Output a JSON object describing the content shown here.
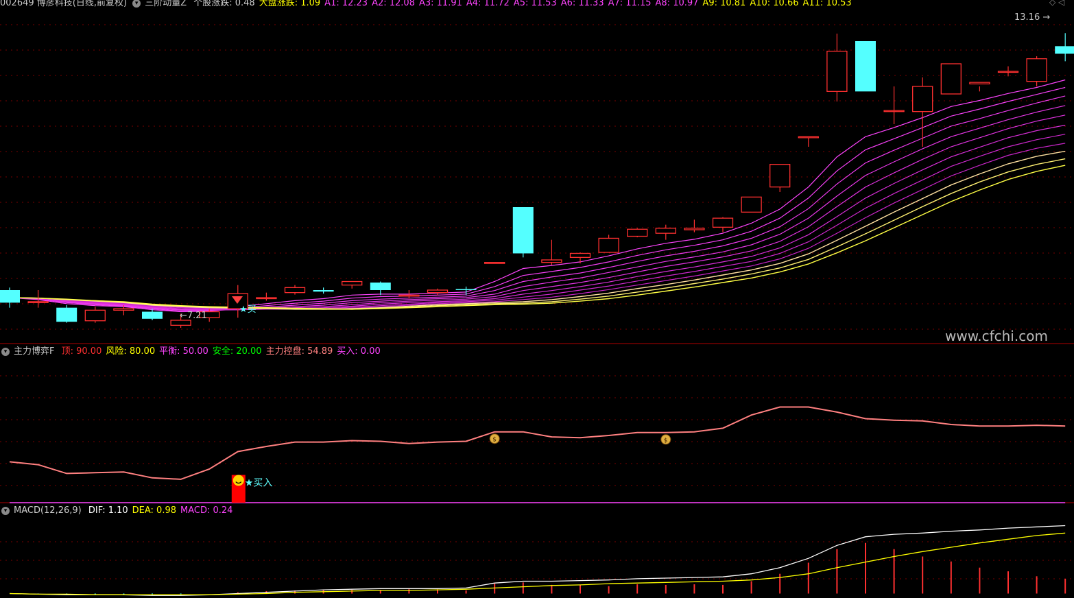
{
  "header": {
    "stock": "002649 博彦科技(日线,前复权)",
    "indicator": "三阶动量Z",
    "items": [
      {
        "label": "个股涨跌",
        "value": "0.48",
        "color": "#d0d0d0"
      },
      {
        "label": "大盘涨跌",
        "value": "1.09",
        "color": "#ffff00"
      },
      {
        "label": "A1",
        "value": "12.23",
        "color": "#ff44ff"
      },
      {
        "label": "A2",
        "value": "12.08",
        "color": "#ff44ff"
      },
      {
        "label": "A3",
        "value": "11.91",
        "color": "#ff44ff"
      },
      {
        "label": "A4",
        "value": "11.72",
        "color": "#ff44ff"
      },
      {
        "label": "A5",
        "value": "11.53",
        "color": "#ff44ff"
      },
      {
        "label": "A6",
        "value": "11.33",
        "color": "#ff44ff"
      },
      {
        "label": "A7",
        "value": "11.15",
        "color": "#ff44ff"
      },
      {
        "label": "A8",
        "value": "10.97",
        "color": "#ff44ff"
      },
      {
        "label": "A9",
        "value": "10.81",
        "color": "#ffff00"
      },
      {
        "label": "A10",
        "value": "10.66",
        "color": "#ffff00"
      },
      {
        "label": "A11",
        "value": "10.53",
        "color": "#ffff00"
      }
    ]
  },
  "main_annotations": {
    "high_label": "13.16",
    "low_label": "7.21",
    "buy_label": "★买",
    "watermark": "www.cfchi.com"
  },
  "panel2": {
    "title": "主力博弈F",
    "items": [
      {
        "label": "顶",
        "value": "90.00",
        "color": "#ff3030"
      },
      {
        "label": "风险",
        "value": "80.00",
        "color": "#ffff00"
      },
      {
        "label": "平衡",
        "value": "50.00",
        "color": "#ff44ff"
      },
      {
        "label": "安全",
        "value": "20.00",
        "color": "#00ff00"
      },
      {
        "label": "主力控盘",
        "value": "54.89",
        "color": "#ff8080"
      },
      {
        "label": "买入",
        "value": "0.00",
        "color": "#ff44ff"
      }
    ],
    "buy_label": "★买入"
  },
  "panel3": {
    "title": "MACD(12,26,9)",
    "items": [
      {
        "label": "DIF",
        "value": "1.10",
        "color": "#ffffff"
      },
      {
        "label": "DEA",
        "value": "0.98",
        "color": "#ffff00"
      },
      {
        "label": "MACD",
        "value": "0.24",
        "color": "#ff44ff"
      }
    ]
  },
  "colors": {
    "up": "#ff3030",
    "down": "#54ffff",
    "ma_start": "#ff44ff",
    "ma_end": "#ffff44",
    "control_line": "#ff8080",
    "dif": "#ffffff",
    "dea": "#ffff00",
    "grid": "#7a0000"
  },
  "chart_data": [
    {
      "type": "candlestick",
      "title": "002649 博彦科技(日线,前复权)",
      "ohlc": [
        [
          8.05,
          8.1,
          7.7,
          7.8
        ],
        [
          7.8,
          8.05,
          7.7,
          7.82
        ],
        [
          7.7,
          7.75,
          7.4,
          7.42
        ],
        [
          7.44,
          7.72,
          7.4,
          7.65
        ],
        [
          7.65,
          7.75,
          7.55,
          7.68
        ],
        [
          7.62,
          7.68,
          7.45,
          7.48
        ],
        [
          7.35,
          7.58,
          7.3,
          7.45
        ],
        [
          7.5,
          7.68,
          7.42,
          7.62
        ],
        [
          7.68,
          8.15,
          7.5,
          7.98
        ],
        [
          7.9,
          8.0,
          7.84,
          7.9
        ],
        [
          8.0,
          8.15,
          7.96,
          8.1
        ],
        [
          8.05,
          8.1,
          7.98,
          8.02
        ],
        [
          8.15,
          8.2,
          8.08,
          8.22
        ],
        [
          8.2,
          8.22,
          7.95,
          8.05
        ],
        [
          7.95,
          8.05,
          7.88,
          7.95
        ],
        [
          8.0,
          8.08,
          7.95,
          8.05
        ],
        [
          8.07,
          8.12,
          7.95,
          8.05
        ],
        [
          8.6,
          8.6,
          8.6,
          8.6
        ],
        [
          9.7,
          9.7,
          8.7,
          8.78
        ],
        [
          8.6,
          9.05,
          8.55,
          8.65
        ],
        [
          8.7,
          8.8,
          8.58,
          8.78
        ],
        [
          8.8,
          9.15,
          8.8,
          9.08
        ],
        [
          9.12,
          9.28,
          9.1,
          9.26
        ],
        [
          9.18,
          9.35,
          9.05,
          9.28
        ],
        [
          9.25,
          9.45,
          9.2,
          9.28
        ],
        [
          9.3,
          9.5,
          9.2,
          9.48
        ],
        [
          9.6,
          9.9,
          9.6,
          9.9
        ],
        [
          10.1,
          10.55,
          10.0,
          10.55
        ],
        [
          11.1,
          11.1,
          10.9,
          11.1
        ],
        [
          12.0,
          13.15,
          11.8,
          12.8
        ],
        [
          13.0,
          13.0,
          12.1,
          12.0
        ],
        [
          11.62,
          12.1,
          11.35,
          11.62
        ],
        [
          11.6,
          12.28,
          10.9,
          12.1
        ],
        [
          11.95,
          12.55,
          11.95,
          12.55
        ],
        [
          12.15,
          12.1,
          12.0,
          12.18
        ],
        [
          12.4,
          12.5,
          12.3,
          12.4
        ],
        [
          12.2,
          12.7,
          12.1,
          12.65
        ],
        [
          12.9,
          13.16,
          12.6,
          12.75
        ]
      ],
      "x_count": 38,
      "ylim": [
        7.0,
        13.6
      ],
      "series": [
        {
          "name": "A1",
          "values": [
            7.9,
            7.86,
            7.78,
            7.74,
            7.72,
            7.66,
            7.62,
            7.63,
            7.72,
            7.78,
            7.84,
            7.88,
            7.95,
            7.97,
            7.97,
            7.99,
            8.01,
            8.22,
            8.48,
            8.54,
            8.61,
            8.73,
            8.87,
            8.98,
            9.06,
            9.18,
            9.38,
            9.66,
            10.1,
            10.7,
            11.1,
            11.28,
            11.48,
            11.7,
            11.82,
            11.96,
            12.08,
            12.23
          ]
        },
        {
          "name": "A2",
          "values": [
            7.9,
            7.87,
            7.8,
            7.76,
            7.73,
            7.68,
            7.63,
            7.63,
            7.69,
            7.74,
            7.79,
            7.83,
            7.89,
            7.92,
            7.93,
            7.95,
            7.97,
            8.12,
            8.34,
            8.42,
            8.5,
            8.61,
            8.74,
            8.85,
            8.94,
            9.05,
            9.22,
            9.48,
            9.88,
            10.42,
            10.84,
            11.06,
            11.28,
            11.51,
            11.65,
            11.8,
            11.94,
            12.08
          ]
        },
        {
          "name": "A3",
          "values": [
            7.9,
            7.87,
            7.81,
            7.77,
            7.74,
            7.69,
            7.65,
            7.64,
            7.67,
            7.71,
            7.75,
            7.79,
            7.84,
            7.87,
            7.89,
            7.91,
            7.93,
            8.04,
            8.22,
            8.31,
            8.39,
            8.5,
            8.62,
            8.73,
            8.82,
            8.93,
            9.08,
            9.31,
            9.67,
            10.16,
            10.58,
            10.83,
            11.07,
            11.31,
            11.46,
            11.62,
            11.77,
            11.91
          ]
        },
        {
          "name": "A4",
          "values": [
            7.9,
            7.88,
            7.82,
            7.78,
            7.75,
            7.7,
            7.66,
            7.65,
            7.66,
            7.69,
            7.72,
            7.75,
            7.8,
            7.83,
            7.86,
            7.88,
            7.9,
            7.97,
            8.12,
            8.21,
            8.29,
            8.4,
            8.51,
            8.62,
            8.71,
            8.81,
            8.95,
            9.16,
            9.48,
            9.92,
            10.33,
            10.6,
            10.86,
            11.1,
            11.27,
            11.44,
            11.59,
            11.72
          ]
        },
        {
          "name": "A5",
          "values": [
            7.9,
            7.88,
            7.83,
            7.79,
            7.76,
            7.71,
            7.67,
            7.66,
            7.66,
            7.68,
            7.7,
            7.72,
            7.76,
            7.8,
            7.83,
            7.85,
            7.87,
            7.92,
            8.04,
            8.12,
            8.2,
            8.3,
            8.41,
            8.52,
            8.61,
            8.71,
            8.83,
            9.02,
            9.31,
            9.71,
            10.1,
            10.38,
            10.65,
            10.9,
            11.08,
            11.26,
            11.41,
            11.53
          ]
        },
        {
          "name": "A6",
          "values": [
            7.9,
            7.88,
            7.84,
            7.8,
            7.77,
            7.72,
            7.68,
            7.67,
            7.66,
            7.67,
            7.68,
            7.7,
            7.73,
            7.77,
            7.8,
            7.82,
            7.84,
            7.88,
            7.97,
            8.04,
            8.12,
            8.21,
            8.32,
            8.42,
            8.51,
            8.61,
            8.72,
            8.89,
            9.15,
            9.51,
            9.88,
            10.17,
            10.44,
            10.7,
            10.89,
            11.08,
            11.22,
            11.33
          ]
        },
        {
          "name": "A7",
          "values": [
            7.9,
            7.89,
            7.85,
            7.81,
            7.78,
            7.73,
            7.7,
            7.68,
            7.67,
            7.67,
            7.67,
            7.68,
            7.71,
            7.74,
            7.77,
            7.8,
            7.82,
            7.85,
            7.91,
            7.97,
            8.05,
            8.13,
            8.23,
            8.33,
            8.42,
            8.52,
            8.62,
            8.78,
            9.01,
            9.34,
            9.68,
            9.97,
            10.24,
            10.51,
            10.71,
            10.9,
            11.04,
            11.15
          ]
        },
        {
          "name": "A8",
          "values": [
            7.9,
            7.89,
            7.85,
            7.82,
            7.79,
            7.74,
            7.71,
            7.69,
            7.68,
            7.67,
            7.67,
            7.67,
            7.69,
            7.72,
            7.75,
            7.78,
            7.8,
            7.82,
            7.86,
            7.91,
            7.98,
            8.06,
            8.15,
            8.24,
            8.33,
            8.43,
            8.53,
            8.67,
            8.88,
            9.18,
            9.49,
            9.78,
            10.05,
            10.32,
            10.53,
            10.73,
            10.87,
            10.97
          ]
        },
        {
          "name": "A9",
          "values": [
            7.9,
            7.89,
            7.86,
            7.83,
            7.8,
            7.75,
            7.72,
            7.7,
            7.69,
            7.68,
            7.67,
            7.67,
            7.68,
            7.7,
            7.73,
            7.76,
            7.78,
            7.8,
            7.82,
            7.86,
            7.92,
            7.99,
            8.08,
            8.16,
            8.25,
            8.35,
            8.45,
            8.58,
            8.77,
            9.04,
            9.32,
            9.6,
            9.87,
            10.14,
            10.36,
            10.56,
            10.71,
            10.81
          ]
        },
        {
          "name": "A10",
          "values": [
            7.9,
            7.89,
            7.86,
            7.84,
            7.81,
            7.76,
            7.73,
            7.71,
            7.7,
            7.69,
            7.68,
            7.67,
            7.67,
            7.69,
            7.71,
            7.74,
            7.76,
            7.78,
            7.79,
            7.82,
            7.87,
            7.93,
            8.01,
            8.09,
            8.18,
            8.27,
            8.37,
            8.49,
            8.66,
            8.91,
            9.17,
            9.44,
            9.71,
            9.97,
            10.2,
            10.4,
            10.55,
            10.66
          ]
        },
        {
          "name": "A11",
          "values": [
            7.9,
            7.89,
            7.87,
            7.84,
            7.82,
            7.77,
            7.74,
            7.72,
            7.71,
            7.7,
            7.69,
            7.68,
            7.67,
            7.68,
            7.7,
            7.72,
            7.74,
            7.76,
            7.77,
            7.79,
            7.83,
            7.88,
            7.95,
            8.03,
            8.11,
            8.2,
            8.29,
            8.41,
            8.57,
            8.79,
            9.03,
            9.29,
            9.55,
            9.81,
            10.04,
            10.25,
            10.41,
            10.53
          ]
        }
      ]
    },
    {
      "type": "line",
      "title": "主力博弈F",
      "x_count": 38,
      "ylim": [
        0,
        100
      ],
      "series": [
        {
          "name": "主力控盘",
          "values": [
            28.0,
            26.0,
            20.0,
            20.5,
            21.0,
            17.0,
            16.0,
            23.0,
            35.0,
            38.5,
            41.5,
            41.5,
            42.5,
            42.0,
            40.5,
            41.5,
            42.0,
            48.5,
            48.5,
            45.0,
            44.5,
            46.0,
            48.0,
            48.0,
            48.5,
            51.0,
            60.0,
            65.5,
            65.5,
            62.0,
            57.5,
            56.5,
            56.0,
            53.5,
            52.5,
            52.5,
            53.0,
            52.5
          ]
        },
        {
          "name": "买入",
          "values": [
            0.0,
            0.0,
            0.0,
            0.0,
            0.0,
            0.0,
            0.0,
            0.0,
            0.0,
            0.0,
            0.0,
            0.0,
            0.0,
            0.0,
            0.0,
            0.0,
            0.0,
            0.0,
            0.0,
            0.0,
            0.0,
            0.0,
            0.0,
            0.0,
            0.0,
            0.0,
            0.0,
            0.0,
            0.0,
            0.0,
            0.0,
            0.0,
            0.0,
            0.0,
            0.0,
            0.0,
            0.0,
            0.0
          ]
        }
      ],
      "buy_bar_index": 8,
      "buy_bar_value": 19.0,
      "money_markers": [
        17,
        23
      ]
    },
    {
      "type": "bar+line",
      "title": "MACD(12,26,9)",
      "x_count": 38,
      "ylim": [
        -0.05,
        1.25
      ],
      "series": [
        {
          "name": "DIF",
          "values": [
            0.0,
            -0.01,
            -0.02,
            -0.02,
            -0.02,
            -0.03,
            -0.03,
            -0.02,
            0.0,
            0.02,
            0.04,
            0.06,
            0.07,
            0.08,
            0.08,
            0.08,
            0.09,
            0.17,
            0.2,
            0.2,
            0.21,
            0.22,
            0.24,
            0.25,
            0.26,
            0.27,
            0.32,
            0.42,
            0.57,
            0.78,
            0.92,
            0.96,
            0.98,
            1.01,
            1.03,
            1.06,
            1.08,
            1.1
          ]
        },
        {
          "name": "DEA",
          "values": [
            0.0,
            -0.01,
            -0.01,
            -0.02,
            -0.02,
            -0.02,
            -0.02,
            -0.02,
            -0.01,
            0.0,
            0.02,
            0.03,
            0.04,
            0.05,
            0.05,
            0.06,
            0.07,
            0.09,
            0.11,
            0.13,
            0.14,
            0.16,
            0.17,
            0.18,
            0.19,
            0.2,
            0.22,
            0.26,
            0.32,
            0.42,
            0.51,
            0.6,
            0.68,
            0.75,
            0.82,
            0.88,
            0.94,
            0.98
          ]
        },
        {
          "name": "MACD",
          "values": [
            0.0,
            -0.01,
            -0.01,
            -0.01,
            -0.01,
            -0.01,
            -0.01,
            0.0,
            0.02,
            0.04,
            0.05,
            0.06,
            0.06,
            0.06,
            0.07,
            0.07,
            0.05,
            0.16,
            0.18,
            0.14,
            0.14,
            0.12,
            0.15,
            0.14,
            0.15,
            0.14,
            0.2,
            0.32,
            0.5,
            0.72,
            0.82,
            0.72,
            0.6,
            0.52,
            0.42,
            0.36,
            0.28,
            0.24
          ]
        }
      ]
    }
  ]
}
